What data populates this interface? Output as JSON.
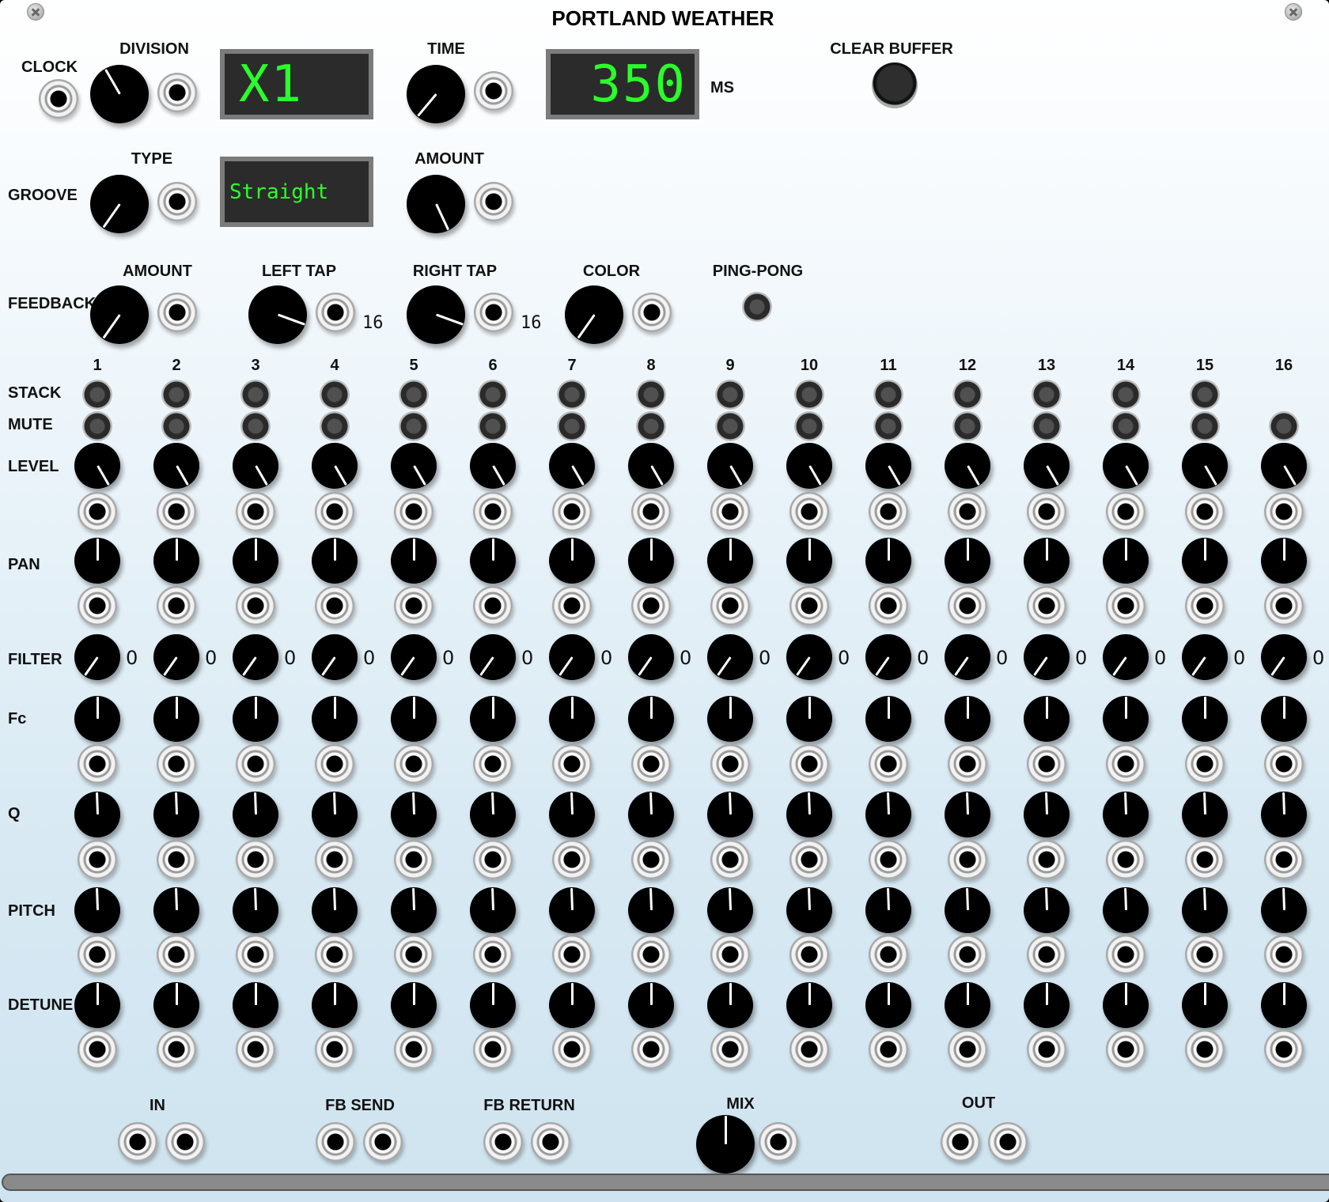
{
  "title": "PORTLAND WEATHER",
  "icons": {
    "screw_left": "screw-icon",
    "screw_right": "screw-icon"
  },
  "colors": {
    "display_text": "#2bff2b",
    "display_bg": "#2b2b2b",
    "panel_top": "#ffffff",
    "panel_bottom": "#cfe4f0"
  },
  "clock": {
    "label": "CLOCK"
  },
  "division": {
    "label": "DIVISION",
    "display": "X1"
  },
  "time": {
    "label": "TIME",
    "display": "350",
    "unit": "MS"
  },
  "clear_buffer": {
    "label": "CLEAR BUFFER"
  },
  "groove": {
    "label": "GROOVE",
    "type_label": "TYPE",
    "display": "Straight",
    "amount_label": "AMOUNT"
  },
  "feedback": {
    "label": "FEEDBACK",
    "amount_label": "AMOUNT",
    "left_tap_label": "LEFT TAP",
    "left_tap_value": "16",
    "right_tap_label": "RIGHT TAP",
    "right_tap_value": "16",
    "color_label": "COLOR",
    "ping_pong_label": "PING-PONG"
  },
  "rows": {
    "stack": "STACK",
    "mute": "MUTE",
    "level": "LEVEL",
    "pan": "PAN",
    "filter": "FILTER",
    "fc": "Fc",
    "q": "Q",
    "pitch": "PITCH",
    "detune": "DETUNE"
  },
  "taps": [
    "1",
    "2",
    "3",
    "4",
    "5",
    "6",
    "7",
    "8",
    "9",
    "10",
    "11",
    "12",
    "13",
    "14",
    "15",
    "16"
  ],
  "filter_values": [
    "0",
    "0",
    "0",
    "0",
    "0",
    "0",
    "0",
    "0",
    "0",
    "0",
    "0",
    "0",
    "0",
    "0",
    "0",
    "0"
  ],
  "bottom": {
    "in": "IN",
    "fb_send": "FB SEND",
    "fb_return": "FB RETURN",
    "mix": "MIX",
    "out": "OUT"
  }
}
